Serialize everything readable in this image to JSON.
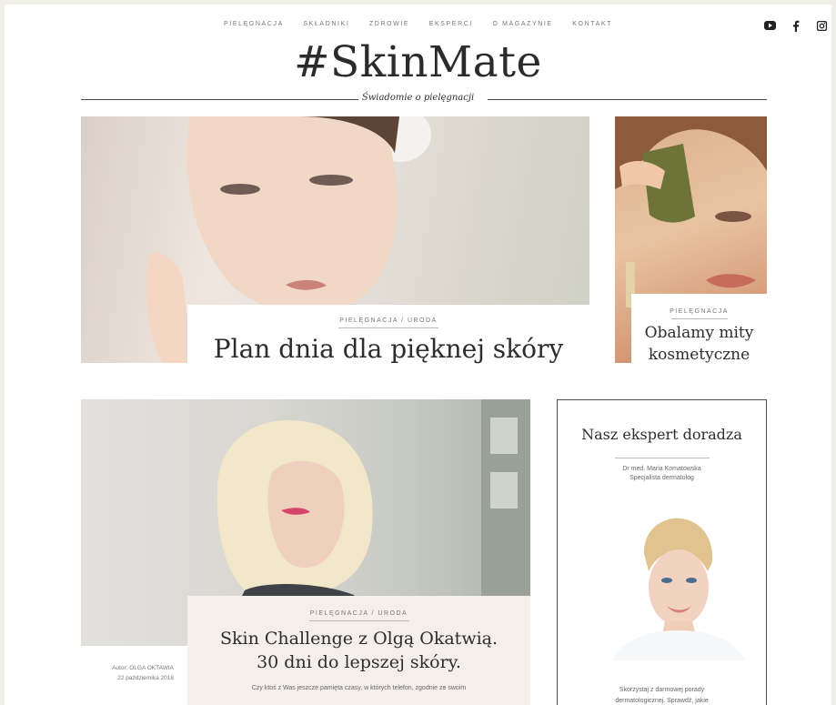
{
  "nav": {
    "items": [
      "PIELĘGNACJA",
      "SKŁADNIKI",
      "ZDROWIE",
      "EKSPERCI",
      "O MAGAZYNIE",
      "KONTAKT"
    ]
  },
  "social": {
    "icons": [
      "youtube-icon",
      "facebook-icon",
      "instagram-icon"
    ]
  },
  "brand": {
    "logo": "#SkinMate",
    "tagline": "Świadomie o pielęgnacji"
  },
  "hero": {
    "category": "PIELĘGNACJA   /   URODA",
    "title": "Plan dnia dla pięknej skóry"
  },
  "side": {
    "category": "PIELĘGNACJA",
    "title_line1": "Obalamy mity",
    "title_line2": "kosmetyczne"
  },
  "article": {
    "category": "PIELĘGNACJA   /   URODA",
    "title_line1": "Skin Challenge z Olgą Okatwią.",
    "title_line2": "30 dni do lepszej skóry.",
    "excerpt": "Czy ktoś z Was jeszcze pamięta czasy, w których telefon, zgodnie ze swoim",
    "author": "Autor: OLGA OKTAWIA",
    "date": "22 października 2018"
  },
  "expert": {
    "title": "Nasz ekspert doradza",
    "name": "Dr med. Maria Komatowska",
    "role": "Specjalista dermatolog",
    "text_line1": "Skorzystaj z darmowej porady",
    "text_line2": "dermatologicznej. Sprawdź, jakie"
  },
  "colors": {
    "accent_card": "#f5efeb",
    "text": "#2d2d2d",
    "bg": "#efeee7"
  }
}
